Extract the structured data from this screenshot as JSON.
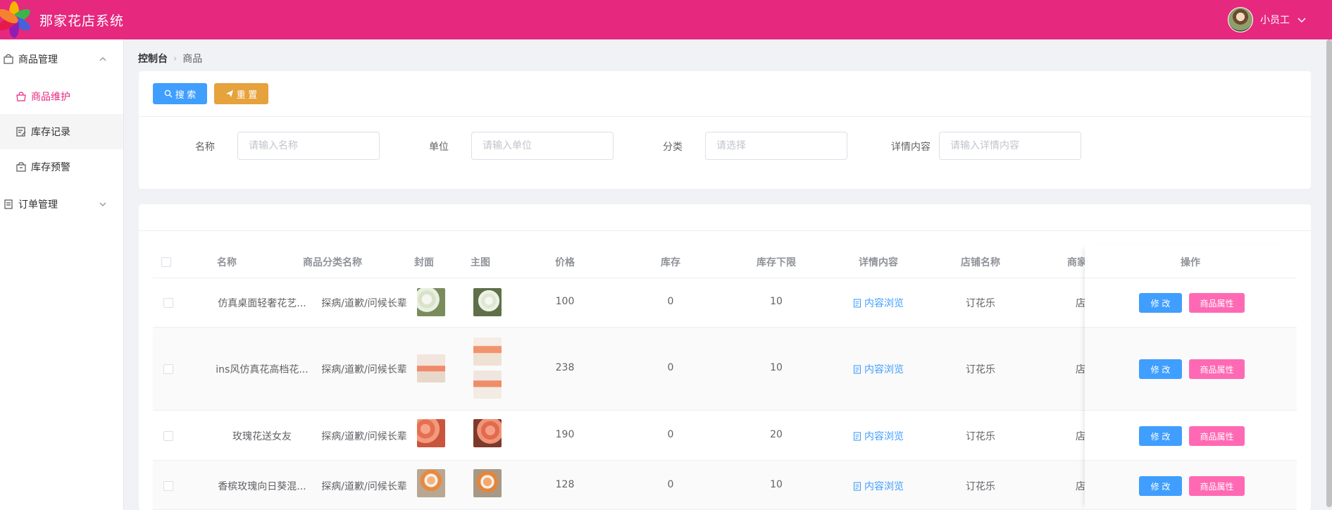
{
  "app": {
    "title": "那家花店系统"
  },
  "user": {
    "name": "小员工"
  },
  "sidebar": {
    "groups": [
      {
        "label": "商品管理",
        "expanded": true,
        "items": [
          {
            "label": "商品维护",
            "active": true
          },
          {
            "label": "库存记录",
            "active": false
          },
          {
            "label": "库存预警",
            "active": false
          }
        ]
      },
      {
        "label": "订单管理",
        "expanded": false,
        "items": []
      }
    ]
  },
  "breadcrumb": {
    "root": "控制台",
    "current": "商品"
  },
  "toolbar": {
    "search_label": "搜 索",
    "reset_label": "重 置"
  },
  "filters": [
    {
      "label": "名称",
      "placeholder": "请输入名称"
    },
    {
      "label": "单位",
      "placeholder": "请输入单位"
    },
    {
      "label": "分类",
      "placeholder": "请选择"
    },
    {
      "label": "详情内容",
      "placeholder": "请输入详情内容"
    }
  ],
  "table": {
    "columns": [
      "名称",
      "商品分类名称",
      "封面",
      "主图",
      "价格",
      "库存",
      "库存下限",
      "详情内容",
      "店铺名称",
      "商家",
      "操作"
    ],
    "rows": [
      {
        "name": "仿真桌面轻奢花艺...",
        "category": "探病/道歉/问候长辈",
        "price": "100",
        "stock": "0",
        "min_stock": "10",
        "detail": "内容浏览",
        "shop": "订花乐",
        "merchant": "店"
      },
      {
        "name": "ins风仿真花高档花...",
        "category": "探病/道歉/问候长辈",
        "price": "238",
        "stock": "0",
        "min_stock": "10",
        "detail": "内容浏览",
        "shop": "订花乐",
        "merchant": "店"
      },
      {
        "name": "玫瑰花送女友",
        "category": "探病/道歉/问候长辈",
        "price": "190",
        "stock": "0",
        "min_stock": "20",
        "detail": "内容浏览",
        "shop": "订花乐",
        "merchant": "店"
      },
      {
        "name": "香槟玫瑰向日葵混...",
        "category": "探病/道歉/问候长辈",
        "price": "128",
        "stock": "0",
        "min_stock": "10",
        "detail": "内容浏览",
        "shop": "订花乐",
        "merchant": "店"
      }
    ],
    "actions": {
      "edit": "修 改",
      "attrs": "商品属性"
    }
  },
  "colors": {
    "brand": "#e6287f",
    "primary": "#409eff",
    "warning": "#e6a23c",
    "pink": "#ff69b4"
  },
  "icons": [
    "logo-icon",
    "chevron-down-icon",
    "bag-icon",
    "chevron-up-icon",
    "shopping-bag-icon",
    "edit-list-icon",
    "box-alert-icon",
    "document-icon",
    "search-icon",
    "send-icon",
    "doc-link-icon"
  ]
}
